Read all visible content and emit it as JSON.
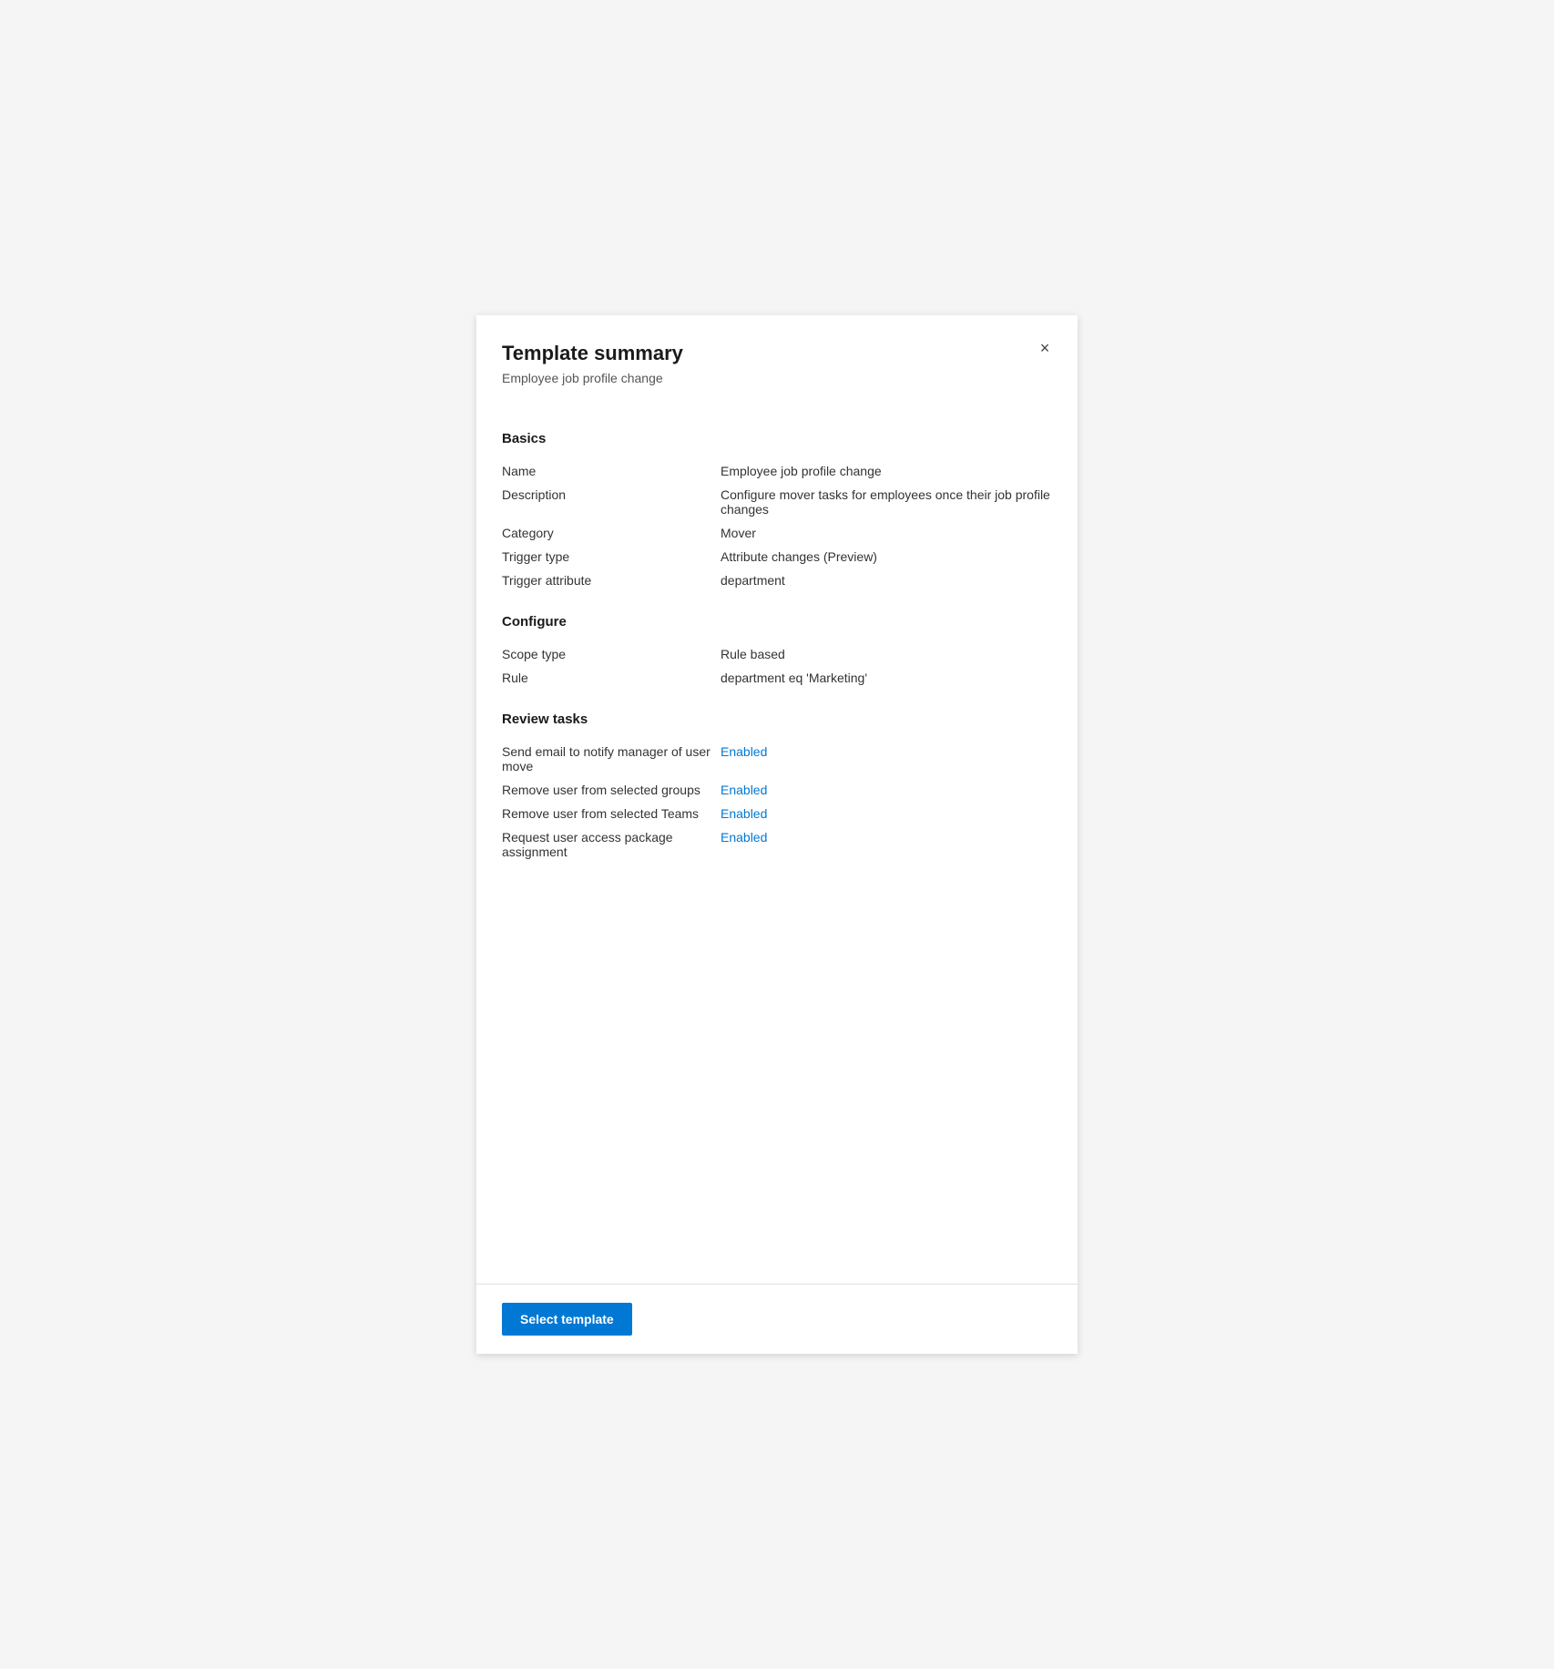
{
  "panel": {
    "title": "Template summary",
    "subtitle": "Employee job profile change",
    "close_icon": "×"
  },
  "sections": {
    "basics": {
      "heading": "Basics",
      "fields": [
        {
          "label": "Name",
          "value": "Employee job profile change",
          "enabled": false
        },
        {
          "label": "Description",
          "value": "Configure mover tasks for employees once their job profile changes",
          "enabled": false
        },
        {
          "label": "Category",
          "value": "Mover",
          "enabled": false
        },
        {
          "label": "Trigger type",
          "value": "Attribute changes (Preview)",
          "enabled": false
        },
        {
          "label": "Trigger attribute",
          "value": "department",
          "enabled": false
        }
      ]
    },
    "configure": {
      "heading": "Configure",
      "fields": [
        {
          "label": "Scope type",
          "value": "Rule based",
          "enabled": false
        },
        {
          "label": "Rule",
          "value": "department eq 'Marketing'",
          "enabled": false
        }
      ]
    },
    "review_tasks": {
      "heading": "Review tasks",
      "fields": [
        {
          "label": "Send email to notify manager of user move",
          "value": "Enabled",
          "enabled": true
        },
        {
          "label": "Remove user from selected groups",
          "value": "Enabled",
          "enabled": true
        },
        {
          "label": "Remove user from selected Teams",
          "value": "Enabled",
          "enabled": true
        },
        {
          "label": "Request user access package assignment",
          "value": "Enabled",
          "enabled": true
        }
      ]
    }
  },
  "footer": {
    "select_template_label": "Select template"
  }
}
